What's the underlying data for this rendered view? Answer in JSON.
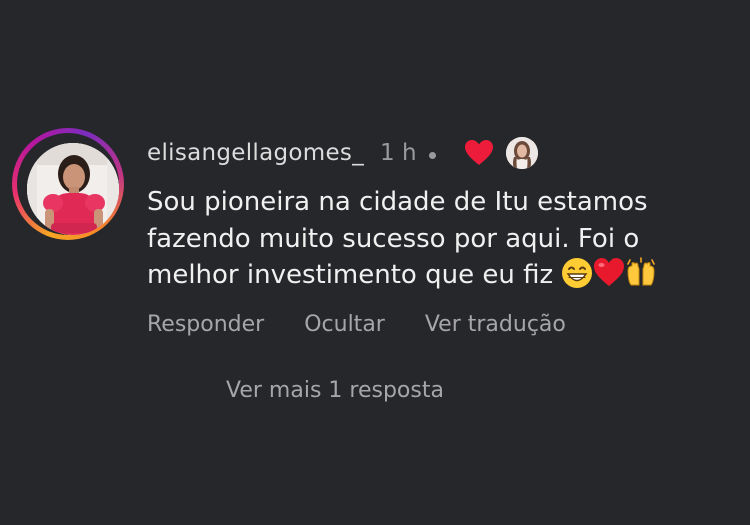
{
  "comment": {
    "username": "elisangellagomes_",
    "time": "1 h",
    "liked_by_author": true,
    "lines": [
      "Sou pioneira na cidade de Itu  estamos",
      "fazendo muito sucesso por aqui. Foi o",
      "melhor investimento que eu fiz"
    ],
    "trailing_emojis": [
      "grinning-face-emoji",
      "red-heart-emoji",
      "raising-hands-emoji"
    ]
  },
  "actions": {
    "reply": "Responder",
    "hide": "Ocultar",
    "translate": "Ver tradução"
  },
  "replies": {
    "more_label": "Ver mais 1 resposta"
  },
  "colors": {
    "background": "#26272b",
    "username": "#dcdcdc",
    "meta": "#9a9a9e",
    "body_text": "#f0f0f0",
    "action_text": "#a6a6aa",
    "heart": "#ed1c3a"
  }
}
